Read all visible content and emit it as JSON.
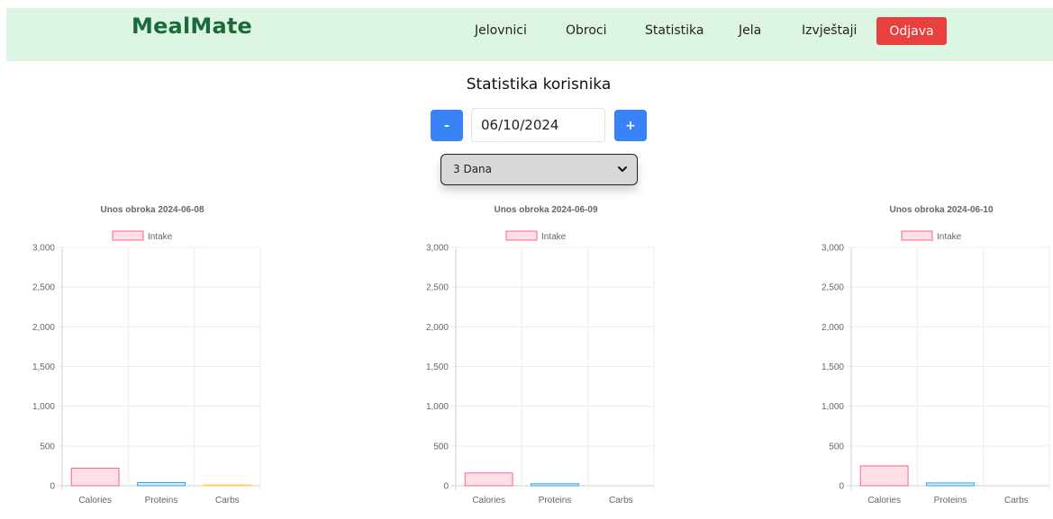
{
  "navbar": {
    "brand": "MealMate",
    "links": [
      "Jelovnici",
      "Obroci",
      "Statistika",
      "Jela",
      "Izvještaji"
    ],
    "logout_label": "Odjava",
    "colors": {
      "background": "#ddf6e3",
      "brand": "#1b6a3a",
      "logout": "#e8403f"
    }
  },
  "page": {
    "title": "Statistika korisnika",
    "decrement_label": "-",
    "increment_label": "+",
    "date_value": "06/10/2024",
    "range_selected": "3 Dana",
    "accent": "#3a82f7"
  },
  "chart_data": [
    {
      "type": "bar",
      "title": "Unos obroka 2024-06-08",
      "categories": [
        "Calories",
        "Proteins",
        "Carbs"
      ],
      "series": [
        {
          "name": "Intake",
          "values": [
            220,
            40,
            10
          ]
        }
      ],
      "ylim": [
        0,
        3000
      ],
      "yticks": [
        "0",
        "500",
        "1,000",
        "1,500",
        "2,000",
        "2,500",
        "3,000"
      ],
      "legend": "top",
      "grid": true,
      "bar_colors": [
        "#ff6384",
        "#36a2eb",
        "#ffce56"
      ]
    },
    {
      "type": "bar",
      "title": "Unos obroka 2024-06-09",
      "categories": [
        "Calories",
        "Proteins",
        "Carbs"
      ],
      "series": [
        {
          "name": "Intake",
          "values": [
            160,
            25,
            0
          ]
        }
      ],
      "ylim": [
        0,
        3000
      ],
      "yticks": [
        "0",
        "500",
        "1,000",
        "1,500",
        "2,000",
        "2,500",
        "3,000"
      ],
      "legend": "top",
      "grid": true,
      "bar_colors": [
        "#ff6384",
        "#36a2eb",
        "#ffce56"
      ]
    },
    {
      "type": "bar",
      "title": "Unos obroka 2024-06-10",
      "categories": [
        "Calories",
        "Proteins",
        "Carbs"
      ],
      "series": [
        {
          "name": "Intake",
          "values": [
            250,
            35,
            0
          ]
        }
      ],
      "ylim": [
        0,
        3000
      ],
      "yticks": [
        "0",
        "500",
        "1,000",
        "1,500",
        "2,000",
        "2,500",
        "3,000"
      ],
      "legend": "top",
      "grid": true,
      "bar_colors": [
        "#ff6384",
        "#36a2eb",
        "#ffce56"
      ]
    }
  ]
}
